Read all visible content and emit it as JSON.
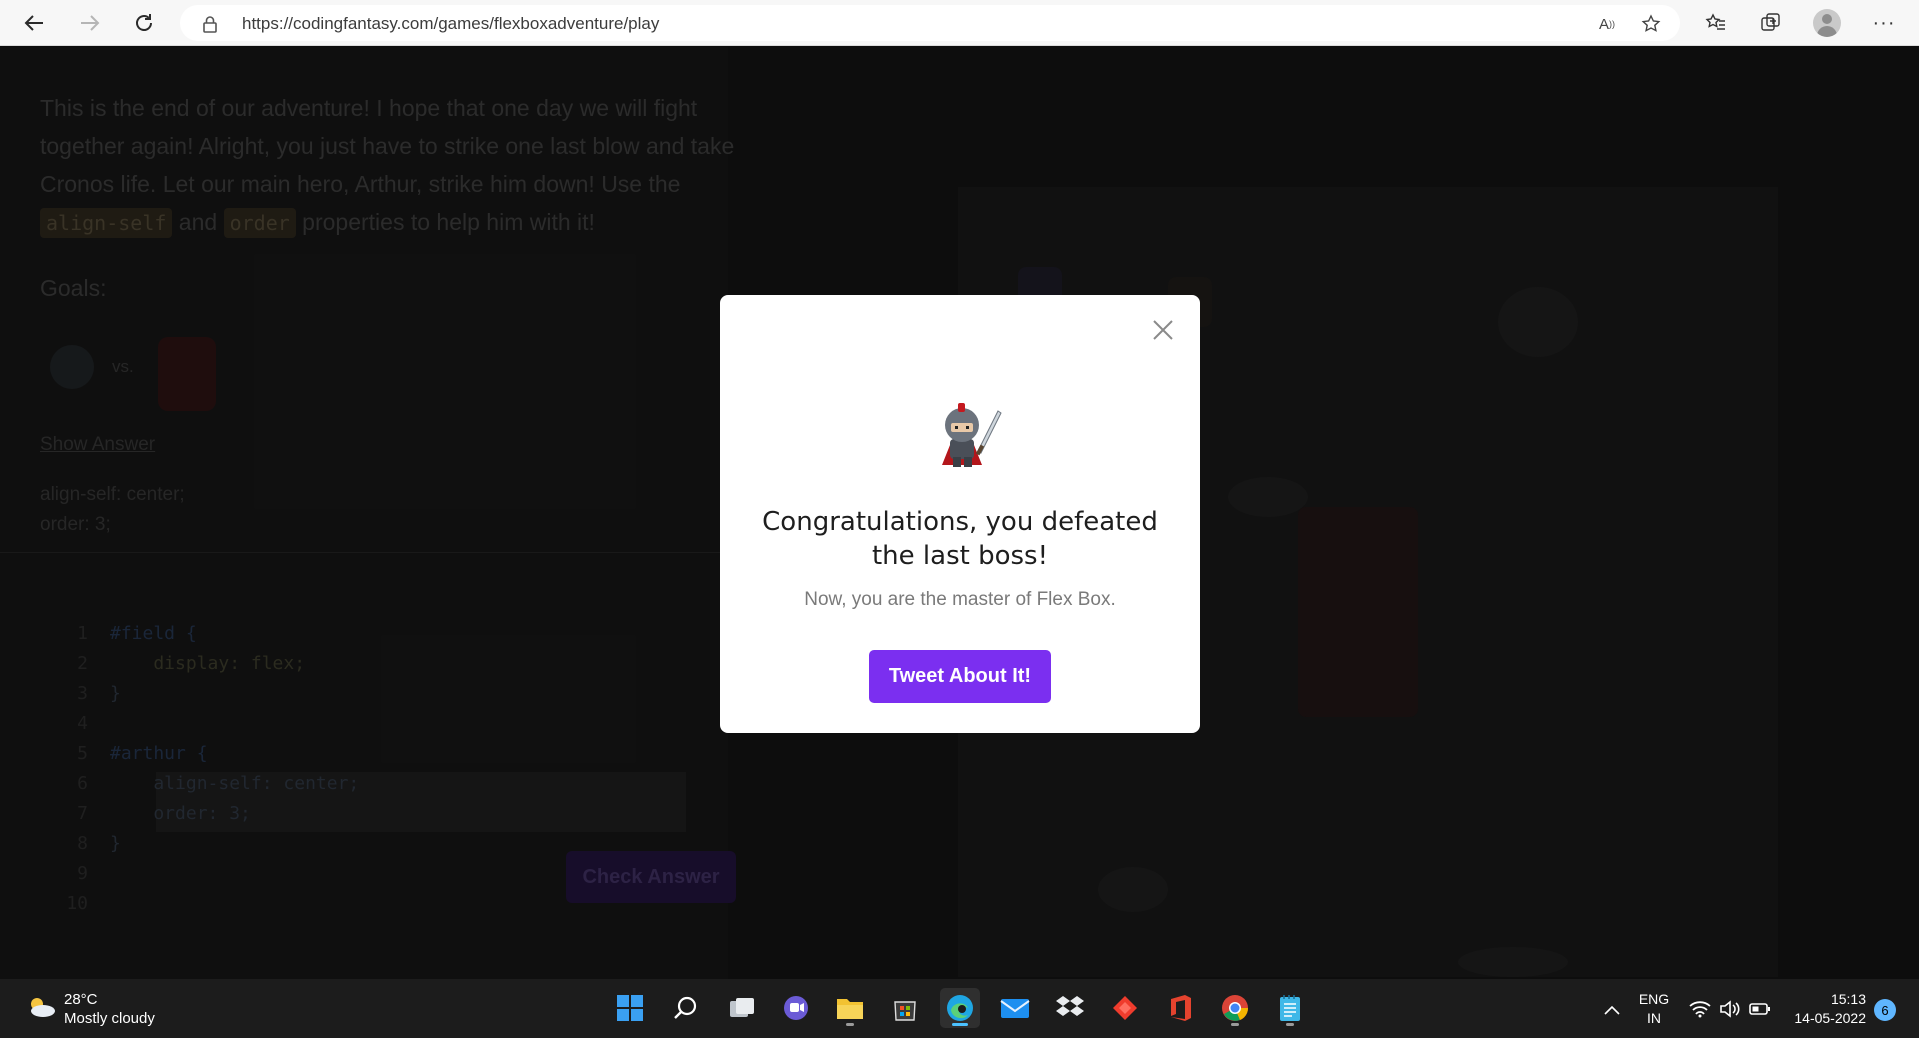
{
  "browser": {
    "url": "https://codingfantasy.com/games/flexboxadventure/play"
  },
  "lesson": {
    "intro_1": "This is the end of our adventure! I hope that one day we will fight together again! Alright, you just have to strike one last blow and take Cronos life. Let our main hero, Arthur, strike him down! Use the ",
    "chip_1": "align-self",
    "intro_2": " and ",
    "chip_2": "order",
    "intro_3": " properties to help him with it!",
    "goals_label": "Goals:",
    "vs": "vs.",
    "show_answer": "Show Answer",
    "answer_1": "align-self: center;",
    "answer_2": "order: 3;"
  },
  "editor": {
    "lines": [
      {
        "n": "1",
        "text": "#field {"
      },
      {
        "n": "2",
        "text": "    display: flex;"
      },
      {
        "n": "3",
        "text": "}"
      },
      {
        "n": "4",
        "text": ""
      },
      {
        "n": "5",
        "text": "#arthur {"
      },
      {
        "n": "6",
        "text": "    align-self: center;"
      },
      {
        "n": "7",
        "text": "    order: 3;"
      },
      {
        "n": "8",
        "text": "}"
      },
      {
        "n": "9",
        "text": ""
      },
      {
        "n": "10",
        "text": ""
      }
    ],
    "check_label": "Check Answer"
  },
  "modal": {
    "title": "Congratulations, you defeated the last boss!",
    "subtitle": "Now, you are the master of Flex Box.",
    "button": "Tweet About It!",
    "accent": "#7b2ff0"
  },
  "taskbar": {
    "temperature": "28°C",
    "condition": "Mostly cloudy",
    "lang_1": "ENG",
    "lang_2": "IN",
    "time": "15:13",
    "date": "14-05-2022",
    "notifications": "6",
    "apps": [
      "start-icon",
      "search-icon",
      "task-view-icon",
      "teams-chat-icon",
      "file-explorer-icon",
      "store-icon",
      "edge-icon",
      "mail-icon",
      "dropbox-icon",
      "anydesk-icon",
      "office-icon",
      "chrome-icon",
      "notepad-icon"
    ]
  }
}
